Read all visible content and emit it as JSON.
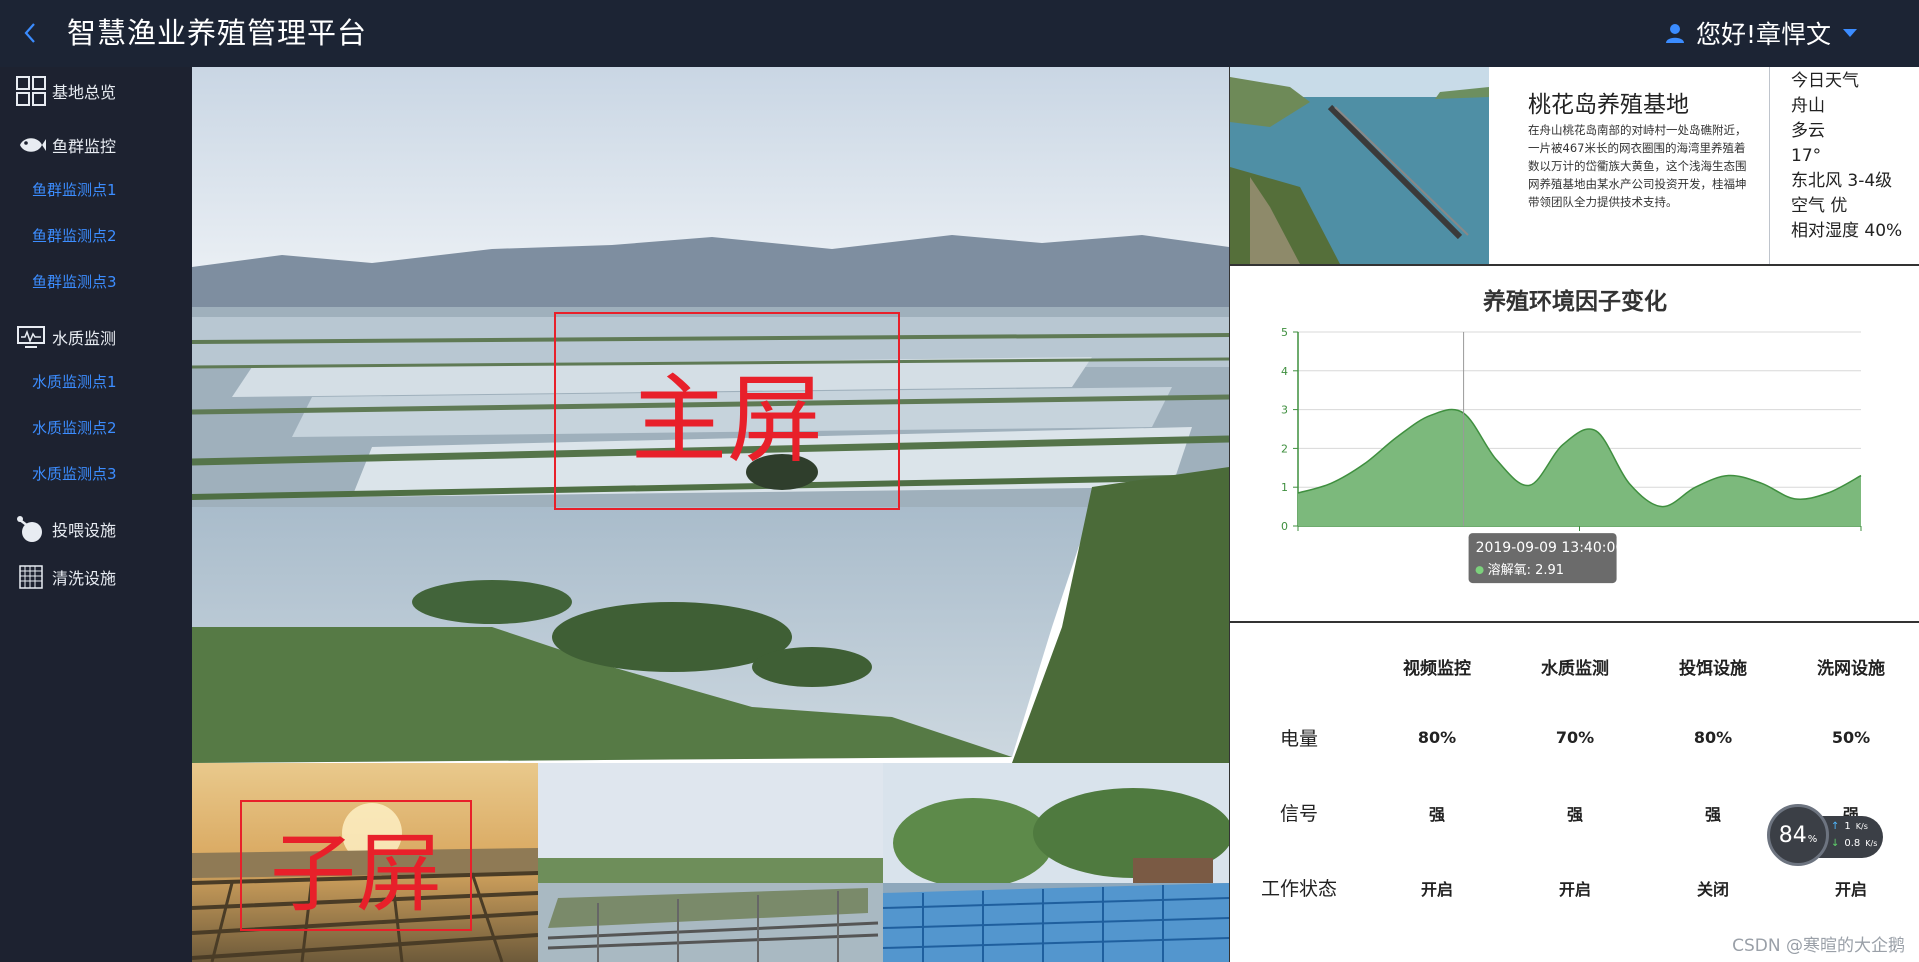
{
  "header": {
    "title": "智慧渔业养殖管理平台",
    "greeting": "您好!章悍文"
  },
  "sidebar": {
    "items": [
      {
        "label": "基地总览",
        "icon": "grid-icon"
      },
      {
        "label": "鱼群监控",
        "icon": "fish-icon",
        "children": [
          "鱼群监测点1",
          "鱼群监测点2",
          "鱼群监测点3"
        ]
      },
      {
        "label": "水质监测",
        "icon": "monitor-icon",
        "children": [
          "水质监测点1",
          "水质监测点2",
          "水质监测点3"
        ]
      },
      {
        "label": "投喂设施",
        "icon": "feeder-icon"
      },
      {
        "label": "清洗设施",
        "icon": "cleaner-icon"
      }
    ]
  },
  "screens": {
    "main_label": "主屏",
    "sub_label": "子屏"
  },
  "base": {
    "name": "桃花岛养殖基地",
    "description": "在舟山桃花岛南部的对峙村一处岛礁附近，一片被467米长的网衣圈围的海湾里养殖着数以万计的岱衢族大黄鱼，这个浅海生态围网养殖基地由某水产公司投资开发，桂福坤带领团队全力提供技术支持。"
  },
  "weather": {
    "label": "今日天气",
    "city": "舟山",
    "condition": "多云",
    "temp": "17°",
    "wind": "东北风 3-4级",
    "air": "空气 优",
    "humidity": "相对湿度 40%"
  },
  "chart_data": {
    "type": "area",
    "title": "养殖环境因子变化",
    "ylim": [
      0,
      5
    ],
    "yticks": [
      "0",
      "1",
      "2",
      "3",
      "4",
      "5"
    ],
    "series": [
      {
        "name": "溶解氧",
        "values": [
          0.85,
          1.1,
          1.6,
          2.3,
          2.85,
          2.91,
          1.7,
          1.05,
          2.1,
          2.45,
          1.1,
          0.5,
          1.0,
          1.3,
          1.1,
          0.7,
          0.85,
          1.3
        ]
      }
    ],
    "tooltip": {
      "time": "2019-09-09 13:40:00",
      "series": "溶解氧",
      "value": 2.91,
      "index": 5
    },
    "colors": {
      "line": "#3f8f3f",
      "fill": "#7cb97c",
      "axis": "#3f8f3f"
    }
  },
  "devices": {
    "columns": [
      "视频监控",
      "水质监测",
      "投饵设施",
      "洗网设施"
    ],
    "rows": [
      {
        "label": "电量",
        "values": [
          "80%",
          "70%",
          "80%",
          "50%"
        ]
      },
      {
        "label": "信号",
        "values": [
          "强",
          "强",
          "强",
          "强"
        ]
      },
      {
        "label": "工作状态",
        "values": [
          "开启",
          "开启",
          "关闭",
          "开启"
        ]
      }
    ]
  },
  "network": {
    "cpu": "84",
    "cpu_unit": "%",
    "up": "1",
    "up_unit": "K/s",
    "down": "0.8",
    "down_unit": "K/s"
  },
  "watermark": "CSDN @寒暄的大企鹅"
}
